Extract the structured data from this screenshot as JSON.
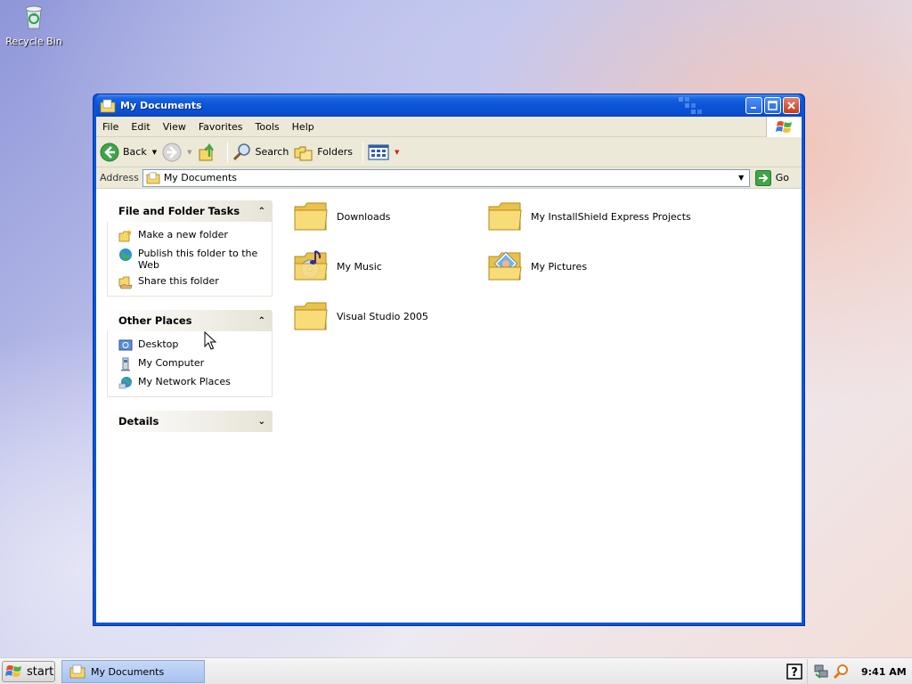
{
  "desktop": {
    "recycle_bin_label": "Recycle Bin"
  },
  "window": {
    "title": "My Documents",
    "menu": [
      "File",
      "Edit",
      "View",
      "Favorites",
      "Tools",
      "Help"
    ],
    "toolbar": {
      "back": "Back",
      "search": "Search",
      "folders": "Folders"
    },
    "address": {
      "label": "Address",
      "value": "My Documents",
      "go": "Go"
    }
  },
  "taskpane": {
    "file_tasks": {
      "title": "File and Folder Tasks",
      "items": [
        "Make a new folder",
        "Publish this folder to the Web",
        "Share this folder"
      ]
    },
    "other_places": {
      "title": "Other Places",
      "items": [
        "Desktop",
        "My Computer",
        "My Network Places"
      ]
    },
    "details": {
      "title": "Details"
    }
  },
  "folders": [
    "Downloads",
    "My InstallShield Express Projects",
    "My Music",
    "My Pictures",
    "Visual Studio 2005"
  ],
  "taskbar": {
    "start": "start",
    "task": "My Documents",
    "clock": "9:41 AM"
  },
  "colors": {
    "title_blue": "#0a54d7",
    "chrome": "#ece9d8",
    "folder_yellow": "#f6d868"
  }
}
